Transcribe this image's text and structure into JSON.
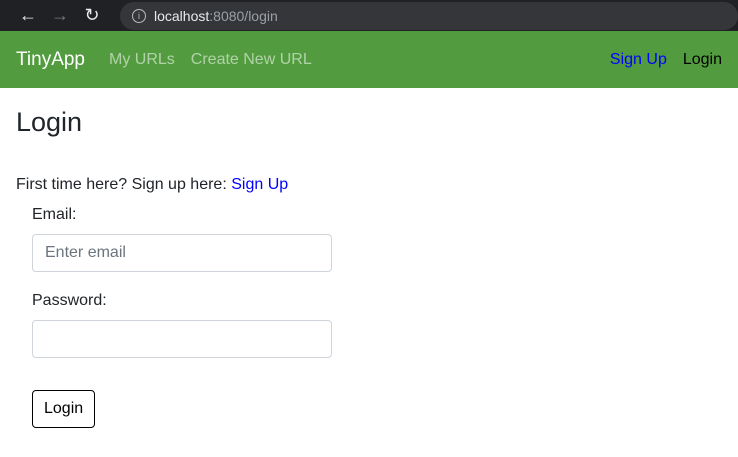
{
  "browser": {
    "host": "localhost",
    "rest": ":8080/login"
  },
  "nav": {
    "brand": "TinyApp",
    "my_urls": "My URLs",
    "create": "Create New URL",
    "signup": "Sign Up",
    "login": "Login"
  },
  "page": {
    "title": "Login",
    "prompt": "First time here? Sign up here: ",
    "signup_link": "Sign Up",
    "email_label": "Email:",
    "email_placeholder": "Enter email",
    "password_label": "Password:",
    "submit": "Login"
  }
}
